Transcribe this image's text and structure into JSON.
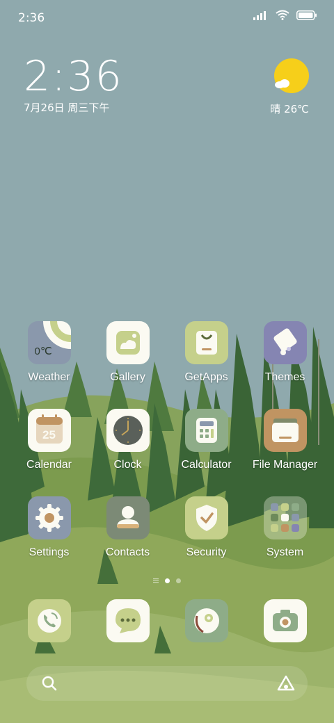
{
  "status_bar": {
    "time": "2:36"
  },
  "clock_widget": {
    "time": "2:36",
    "date": "7月26日 周三下午"
  },
  "weather_widget": {
    "text": "晴 26℃"
  },
  "apps": [
    {
      "label": "Weather",
      "icon": "weather-icon",
      "widget_text": "0℃"
    },
    {
      "label": "Gallery",
      "icon": "gallery-icon"
    },
    {
      "label": "GetApps",
      "icon": "getapps-icon"
    },
    {
      "label": "Themes",
      "icon": "themes-icon"
    },
    {
      "label": "Calendar",
      "icon": "calendar-icon",
      "day": "25"
    },
    {
      "label": "Clock",
      "icon": "clock-icon"
    },
    {
      "label": "Calculator",
      "icon": "calculator-icon"
    },
    {
      "label": "File Manager",
      "icon": "file-manager-icon"
    },
    {
      "label": "Settings",
      "icon": "settings-icon"
    },
    {
      "label": "Contacts",
      "icon": "contacts-icon"
    },
    {
      "label": "Security",
      "icon": "security-icon"
    },
    {
      "label": "System",
      "icon": "system-folder-icon"
    }
  ],
  "dock": [
    {
      "icon": "phone-icon"
    },
    {
      "icon": "messages-icon"
    },
    {
      "icon": "browser-icon"
    },
    {
      "icon": "camera-icon"
    }
  ],
  "pager": {
    "pages": 3,
    "active": 2
  },
  "colors": {
    "sky": "#8fa9ad",
    "hill": "#7c9b4e",
    "forest": "#3e6a3a",
    "icon_green": "#c5d08b",
    "icon_sage": "#8eac88",
    "icon_slate": "#8a98ac",
    "icon_purple": "#8585b2",
    "icon_tan": "#c09462",
    "sun": "#f6cf1a"
  }
}
